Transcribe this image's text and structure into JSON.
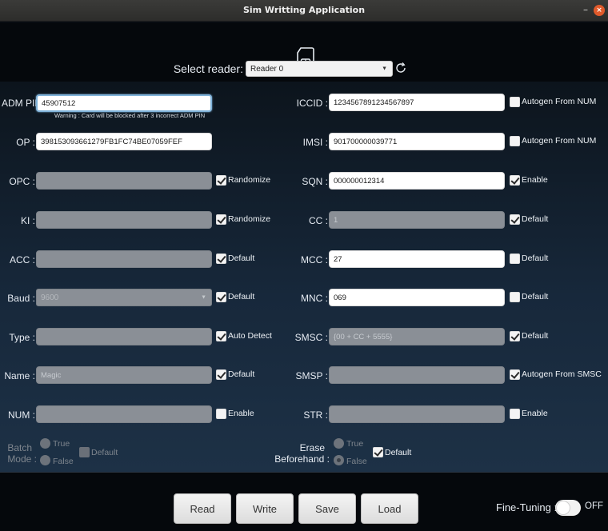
{
  "window": {
    "title": "Sim Writting Application",
    "minimize": "–",
    "close": "×"
  },
  "reader": {
    "label": "Select reader:",
    "value": "Reader 0"
  },
  "left": {
    "adm_pin": {
      "label": "ADM PIN :",
      "value": "45907512",
      "warning": "Warning : Card will be blocked after 3 incorrect ADM PIN"
    },
    "op": {
      "label": "OP :",
      "value": "398153093661279FB1FC74BE07059FEF"
    },
    "opc": {
      "label": "OPC :",
      "value": "",
      "check": "Randomize"
    },
    "ki": {
      "label": "KI :",
      "value": "",
      "check": "Randomize"
    },
    "acc": {
      "label": "ACC :",
      "value": "",
      "check": "Default"
    },
    "baud": {
      "label": "Baud :",
      "value": "9600",
      "check": "Default"
    },
    "type": {
      "label": "Type :",
      "value": "",
      "check": "Auto Detect"
    },
    "name": {
      "label": "Name :",
      "value": "Magic",
      "check": "Default"
    },
    "num": {
      "label": "NUM :",
      "value": "",
      "check": "Enable"
    },
    "batch": {
      "label_line1": "Batch",
      "label_line2": "Mode :",
      "opt_true": "True",
      "opt_false": "False",
      "check": "Default"
    }
  },
  "right": {
    "iccid": {
      "label": "ICCID :",
      "value": "1234567891234567897",
      "check": "Autogen From NUM"
    },
    "imsi": {
      "label": "IMSI :",
      "value": "901700000039771",
      "check": "Autogen From NUM"
    },
    "sqn": {
      "label": "SQN :",
      "value": "000000012314",
      "check": "Enable"
    },
    "cc": {
      "label": "CC :",
      "value": "1",
      "check": "Default"
    },
    "mcc": {
      "label": "MCC :",
      "value": "27",
      "check": "Default"
    },
    "mnc": {
      "label": "MNC :",
      "value": "069",
      "check": "Default"
    },
    "smsc": {
      "label": "SMSC :",
      "value": "{00 + CC + 5555}",
      "check": "Default"
    },
    "smsp": {
      "label": "SMSP :",
      "value": "",
      "check": "Autogen From SMSC"
    },
    "str": {
      "label": "STR :",
      "value": "",
      "check": "Enable"
    },
    "erase": {
      "label_line1": "Erase",
      "label_line2": "Beforehand :",
      "opt_true": "True",
      "opt_false": "False",
      "check": "Default"
    }
  },
  "actions": {
    "read": "Read",
    "write": "Write",
    "save": "Save",
    "load": "Load"
  },
  "fine_tuning": {
    "label": "Fine-Tuning :",
    "state": "OFF"
  }
}
